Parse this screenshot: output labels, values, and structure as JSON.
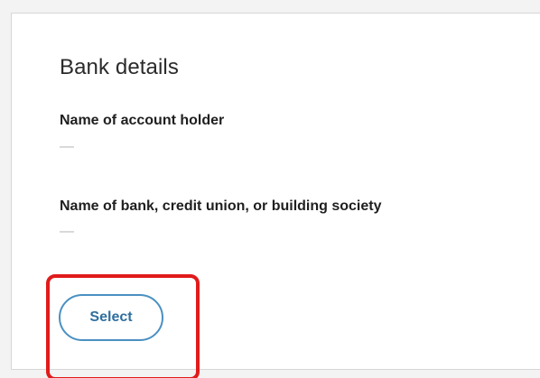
{
  "card": {
    "title": "Bank details",
    "fields": [
      {
        "label": "Name of account holder",
        "value": "—"
      },
      {
        "label": "Name of bank, credit union, or building society",
        "value": "—"
      }
    ],
    "select_label": "Select"
  },
  "colors": {
    "button_border": "#4a90c2",
    "button_text": "#2f6f9f",
    "highlight": "#e11b1b"
  }
}
